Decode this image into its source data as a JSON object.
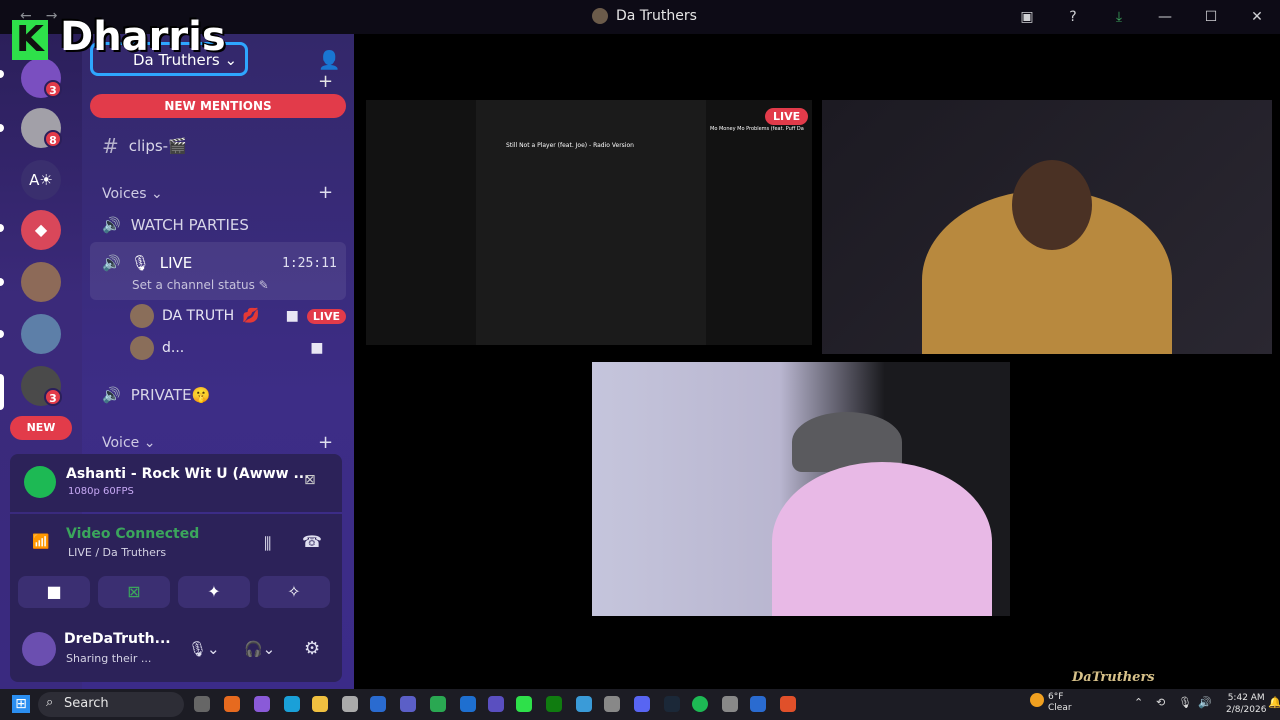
{
  "window": {
    "title": "Da Truthers",
    "controls": [
      "—",
      "☐",
      "✕"
    ]
  },
  "overlay": {
    "logo_text": "Dharris"
  },
  "rail": {
    "badges": [
      "3",
      "8",
      "3"
    ],
    "new_label": "NEW"
  },
  "sidebar": {
    "server_name": "Da Truthers",
    "new_mentions": "NEW MENTIONS",
    "clips_channel": "clips-🎬",
    "voices_category": "Voices",
    "watch_parties": "WATCH PARTIES",
    "live_channel": "LIVE",
    "live_timer": "1:25:11",
    "channel_status": "Set a channel status",
    "user1": "DA TRUTH",
    "user1_live": "LIVE",
    "user2": "d...",
    "private_channel": "PRIVATE🤫",
    "voice_category": "Voice"
  },
  "activity": {
    "track": "Ashanti - Rock Wit U (Awww ...",
    "quality": "1080p 60FPS"
  },
  "voice": {
    "status": "Video Connected",
    "channel": "LIVE / Da Truthers"
  },
  "user": {
    "name": "DreDaTruth...",
    "status": "Sharing their ..."
  },
  "stream": {
    "live_tag": "LIVE",
    "now_playing": "Still Not a Player (feat. Joe) - Radio Version",
    "side_title": "Mo Money Mo Problems (feat. Puff Da"
  },
  "taskbar": {
    "search": "Search",
    "weather_temp": "6°F",
    "weather_desc": "Clear",
    "time": "5:42 AM",
    "date": "2/8/2026"
  },
  "watermark": "DaTruthers",
  "colors": {
    "accent_red": "#e23b4a",
    "sidebar_purple": "#3b2b88",
    "connected_green": "#3ba55c"
  }
}
